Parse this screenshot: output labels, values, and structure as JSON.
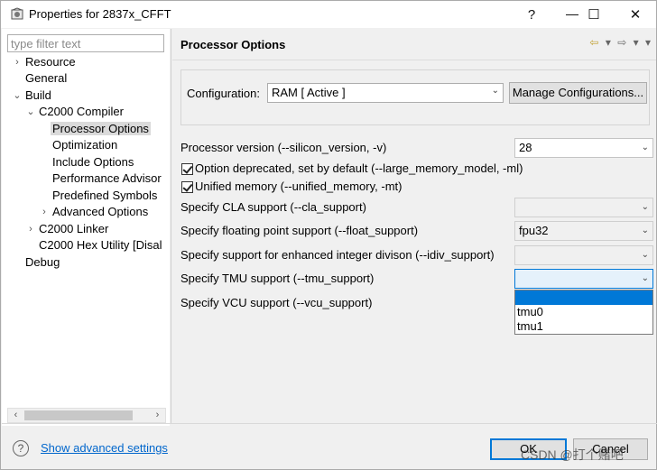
{
  "window": {
    "title": "Properties for 2837x_CFFT",
    "help_glyph": "?",
    "minimize_glyph": "—",
    "maximize_glyph": "☐",
    "close_glyph": "✕"
  },
  "filter": {
    "placeholder": "type filter text",
    "value": ""
  },
  "tree": {
    "items": [
      {
        "label": "Resource",
        "arrow": "›"
      },
      {
        "label": "General",
        "arrow": ""
      },
      {
        "label": "Build",
        "arrow": "⌄"
      },
      {
        "label": "C2000 Compiler",
        "arrow": "⌄"
      },
      {
        "label": "Processor Options",
        "arrow": ""
      },
      {
        "label": "Optimization",
        "arrow": ""
      },
      {
        "label": "Include Options",
        "arrow": ""
      },
      {
        "label": "Performance Advisor",
        "arrow": ""
      },
      {
        "label": "Predefined Symbols",
        "arrow": ""
      },
      {
        "label": "Advanced Options",
        "arrow": "›"
      },
      {
        "label": "C2000 Linker",
        "arrow": "›"
      },
      {
        "label": "C2000 Hex Utility  [Disal",
        "arrow": ""
      },
      {
        "label": "Debug",
        "arrow": ""
      }
    ],
    "selected": "Processor Options",
    "scroll_left": "‹",
    "scroll_right": "›"
  },
  "page": {
    "title": "Processor Options",
    "nav_back": "⇦",
    "nav_forward": "⇨",
    "nav_menu": "▾"
  },
  "configuration": {
    "label": "Configuration:",
    "value": "RAM  [ Active ]",
    "manage_button": "Manage Configurations..."
  },
  "options": {
    "processor_version": {
      "label": "Processor version (--silicon_version, -v)",
      "value": "28"
    },
    "large_memory": {
      "label": "Option deprecated, set by default (--large_memory_model, -ml)",
      "checked": true
    },
    "unified_memory": {
      "label": "Unified memory (--unified_memory, -mt)",
      "checked": true
    },
    "cla_support": {
      "label": "Specify CLA support (--cla_support)",
      "value": ""
    },
    "float_support": {
      "label": "Specify floating point support (--float_support)",
      "value": "fpu32"
    },
    "idiv_support": {
      "label": "Specify support for enhanced integer divison (--idiv_support)",
      "value": ""
    },
    "tmu_support": {
      "label": "Specify TMU support (--tmu_support)",
      "value": ""
    },
    "vcu_support": {
      "label": "Specify VCU support (--vcu_support)"
    }
  },
  "tmu_dropdown": {
    "options": [
      "",
      "tmu0",
      "tmu1"
    ],
    "highlighted_index": 0
  },
  "combo_arrow": "⌄",
  "footer": {
    "help_glyph": "?",
    "advanced_link": "Show advanced settings",
    "ok_button": "OK",
    "cancel_button": "Cancel",
    "watermark": "CSDN @打个赌吧"
  },
  "colors": {
    "accent": "#0078d7",
    "link": "#0066cc",
    "selection": "#dadada"
  }
}
